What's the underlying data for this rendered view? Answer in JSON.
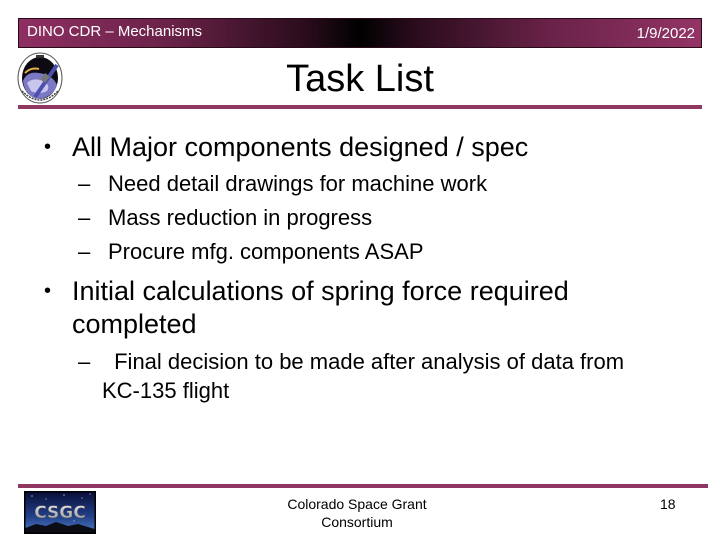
{
  "header": {
    "left_text": "DINO CDR – Mechanisms",
    "date": "1/9/2022"
  },
  "logos": {
    "mission_logo": "dino-mission-logo",
    "footer_logo_text": "CSGC"
  },
  "title": "Task List",
  "bullets": [
    {
      "marker": "•",
      "text": "All Major components designed / spec",
      "subitems": [
        {
          "marker": "–",
          "text": "Need detail drawings for machine work"
        },
        {
          "marker": "–",
          "text": "Mass reduction in progress"
        },
        {
          "marker": "–",
          "text": "Procure mfg. components ASAP"
        }
      ]
    },
    {
      "marker": "•",
      "text_line1": "Initial calculations of spring force required",
      "text_line2": "completed",
      "subitems": [
        {
          "marker": "–",
          "text_line1": " Final decision to be made after analysis of data from",
          "text_line2": "KC-135 flight"
        }
      ]
    }
  ],
  "footer": {
    "org_line1": "Colorado Space Grant",
    "org_line2": "Consortium",
    "page_number": "18"
  },
  "colors": {
    "accent": "#8e3763",
    "header_edge": "#8e2f62",
    "header_center": "#000000"
  }
}
